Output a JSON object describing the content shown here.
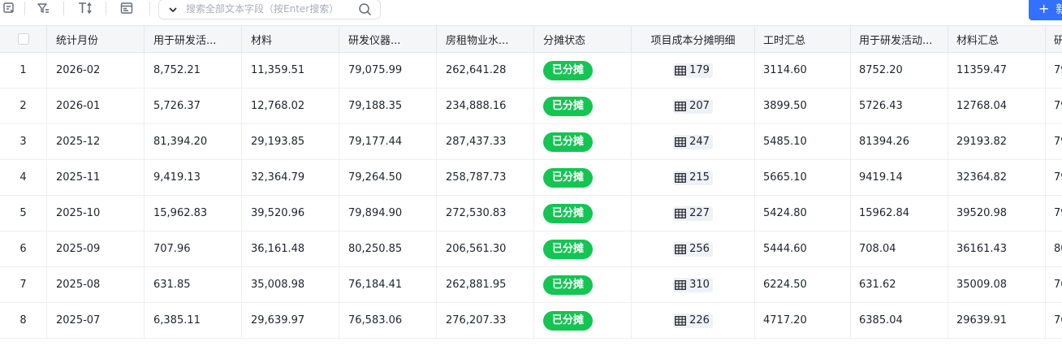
{
  "toolbar": {
    "icons": [
      "record-icon",
      "filter-icon",
      "text-format-icon",
      "form-icon"
    ],
    "search_placeholder": "搜索全部文本字段（按Enter搜索）",
    "new_button_label": "新"
  },
  "table": {
    "columns": [
      "统计月份",
      "用于研发活...",
      "材料",
      "研发仪器...",
      "房租物业水...",
      "分摊状态",
      "项目成本分摊明细",
      "工时汇总",
      "用于研发活动...",
      "材料汇总",
      "研"
    ],
    "rows": [
      {
        "index": "1",
        "month": "2026-02",
        "rd_use": "8,752.21",
        "material": "11,359.51",
        "instrument": "79,075.99",
        "rent": "262,641.28",
        "status": "已分摊",
        "detail_count": "179",
        "hours": "3114.60",
        "rd_use_sum": "8752.20",
        "material_sum": "11359.47",
        "next": "79"
      },
      {
        "index": "2",
        "month": "2026-01",
        "rd_use": "5,726.37",
        "material": "12,768.02",
        "instrument": "79,188.35",
        "rent": "234,888.16",
        "status": "已分摊",
        "detail_count": "207",
        "hours": "3899.50",
        "rd_use_sum": "5726.43",
        "material_sum": "12768.04",
        "next": "79"
      },
      {
        "index": "3",
        "month": "2025-12",
        "rd_use": "81,394.20",
        "material": "29,193.85",
        "instrument": "79,177.44",
        "rent": "287,437.33",
        "status": "已分摊",
        "detail_count": "247",
        "hours": "5485.10",
        "rd_use_sum": "81394.26",
        "material_sum": "29193.82",
        "next": "79"
      },
      {
        "index": "4",
        "month": "2025-11",
        "rd_use": "9,419.13",
        "material": "32,364.79",
        "instrument": "79,264.50",
        "rent": "258,787.73",
        "status": "已分摊",
        "detail_count": "215",
        "hours": "5665.10",
        "rd_use_sum": "9419.14",
        "material_sum": "32364.82",
        "next": "79"
      },
      {
        "index": "5",
        "month": "2025-10",
        "rd_use": "15,962.83",
        "material": "39,520.96",
        "instrument": "79,894.90",
        "rent": "272,530.83",
        "status": "已分摊",
        "detail_count": "227",
        "hours": "5424.80",
        "rd_use_sum": "15962.84",
        "material_sum": "39520.98",
        "next": "79"
      },
      {
        "index": "6",
        "month": "2025-09",
        "rd_use": "707.96",
        "material": "36,161.48",
        "instrument": "80,250.85",
        "rent": "206,561.30",
        "status": "已分摊",
        "detail_count": "256",
        "hours": "5444.60",
        "rd_use_sum": "708.04",
        "material_sum": "36161.43",
        "next": "80"
      },
      {
        "index": "7",
        "month": "2025-08",
        "rd_use": "631.85",
        "material": "35,008.98",
        "instrument": "76,184.41",
        "rent": "262,881.95",
        "status": "已分摊",
        "detail_count": "310",
        "hours": "6224.50",
        "rd_use_sum": "631.62",
        "material_sum": "35009.08",
        "next": "76"
      },
      {
        "index": "8",
        "month": "2025-07",
        "rd_use": "6,385.11",
        "material": "29,639.97",
        "instrument": "76,583.06",
        "rent": "276,207.33",
        "status": "已分摊",
        "detail_count": "226",
        "hours": "4717.20",
        "rd_use_sum": "6385.04",
        "material_sum": "29639.91",
        "next": "76"
      }
    ]
  },
  "colors": {
    "status_green": "#13c552",
    "accent_blue": "#3370ff",
    "header_bg": "#f5f6f7"
  }
}
